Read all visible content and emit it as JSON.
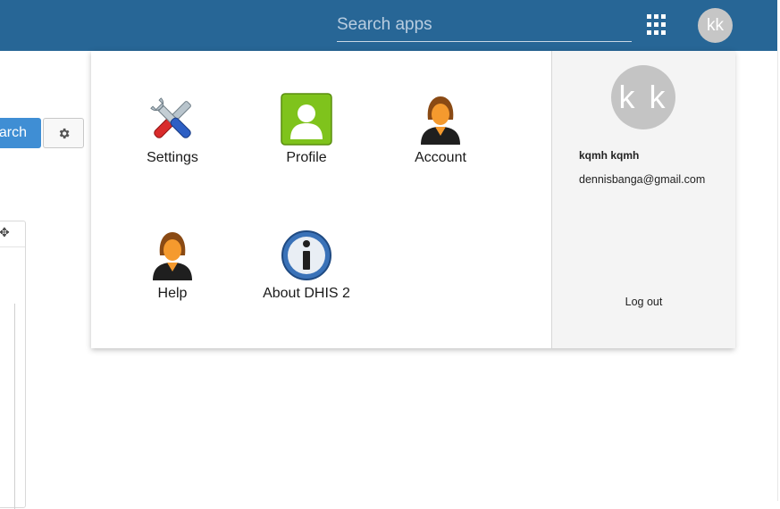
{
  "header": {
    "search_placeholder": "Search apps",
    "avatar_initials": "kk",
    "apps_icon": "apps-grid-icon",
    "bar_color": "#276696"
  },
  "background": {
    "search_button_label": "arch",
    "settings_icon": "gear-icon",
    "move_icon": "move-icon"
  },
  "menu": {
    "tiles": [
      {
        "label": "Settings",
        "icon": "tools-icon"
      },
      {
        "label": "Profile",
        "icon": "profile-card-icon"
      },
      {
        "label": "Account",
        "icon": "person-icon"
      },
      {
        "label": "Help",
        "icon": "person-icon"
      },
      {
        "label": "About DHIS 2",
        "icon": "info-icon"
      }
    ]
  },
  "profile": {
    "initials": "k k",
    "name": "kqmh kqmh",
    "email": "dennisbanga@gmail.com",
    "logout_label": "Log out"
  }
}
